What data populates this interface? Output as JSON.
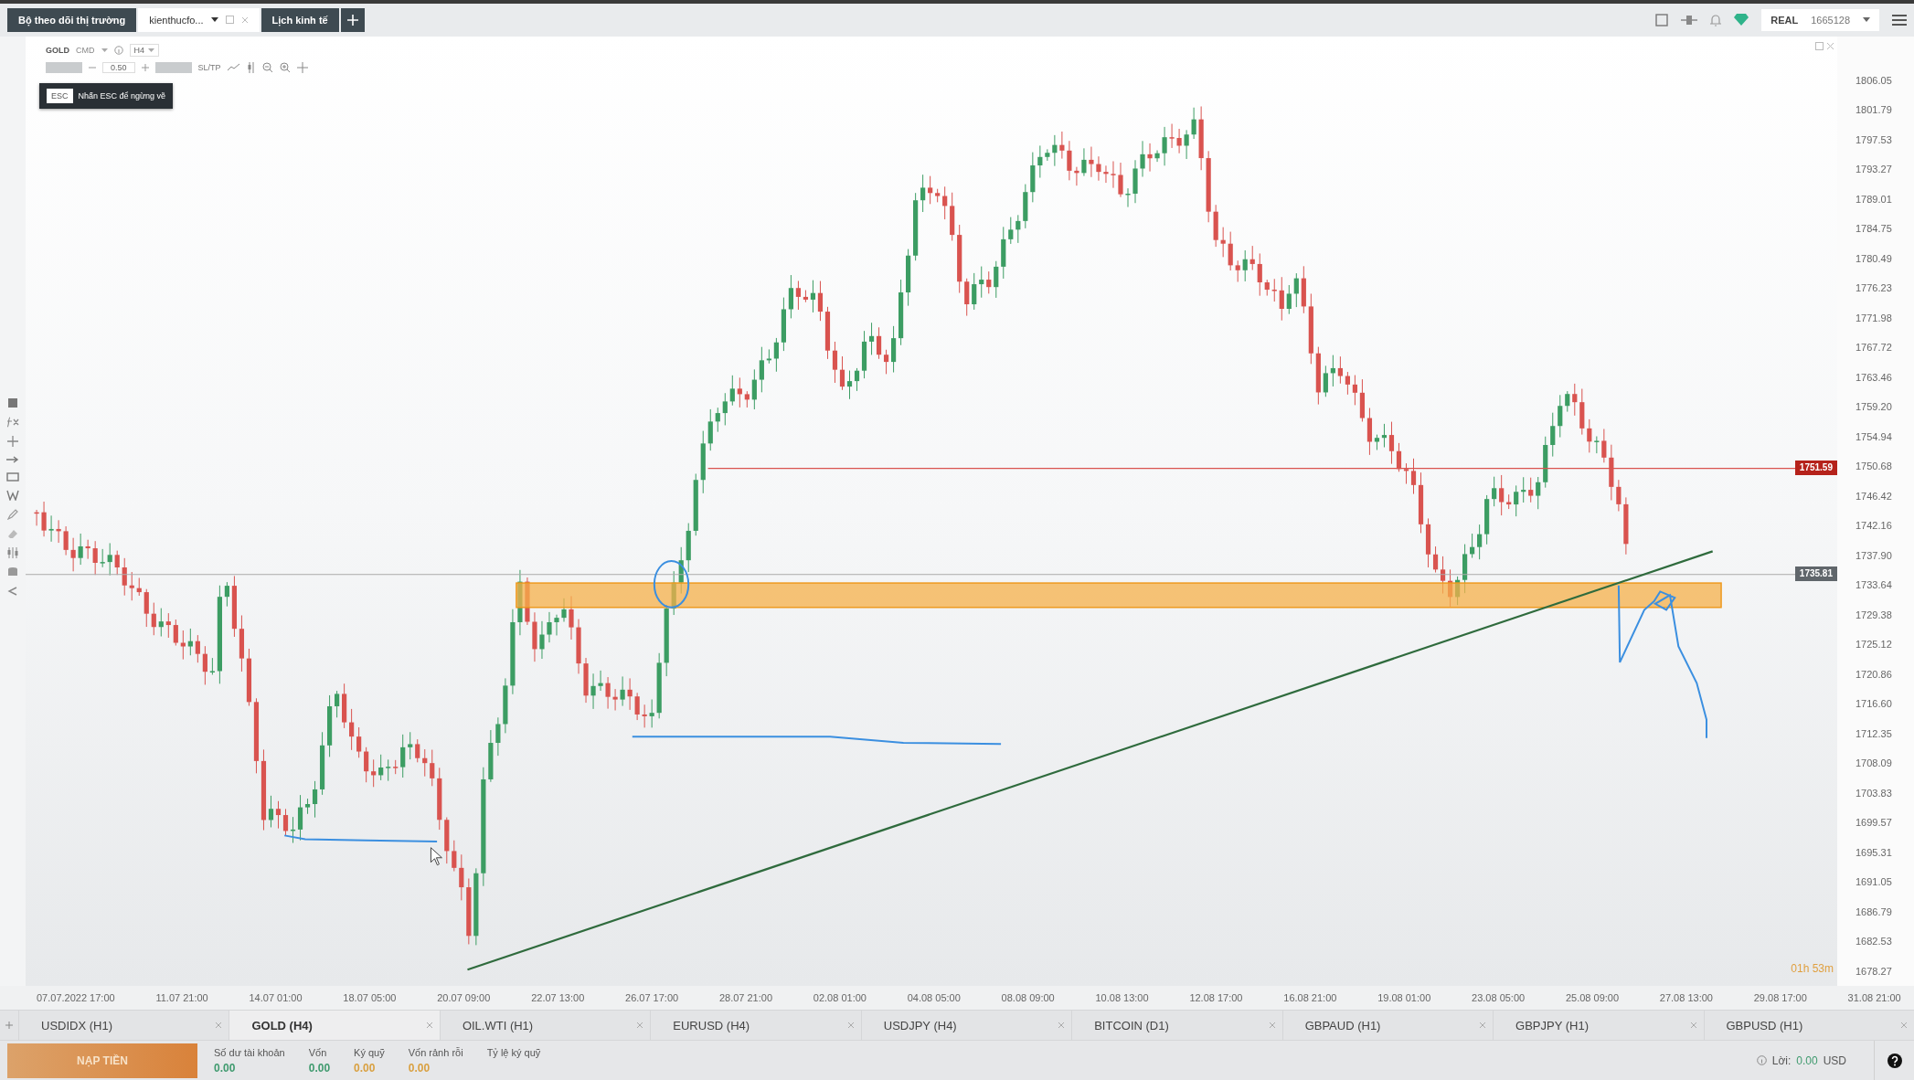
{
  "top_tabs": [
    {
      "label": "Bộ theo dõi thị trường",
      "selected": false,
      "kind": "plain"
    },
    {
      "label": "kienthucfo...",
      "selected": true,
      "kind": "dropdown"
    },
    {
      "label": "Lịch kinh tế",
      "selected": false,
      "kind": "plain"
    }
  ],
  "account": {
    "mode": "REAL",
    "number": "1665128"
  },
  "chart_toolbar": {
    "symbol": "GOLD",
    "market": "CMD",
    "timeframe": "H4",
    "volume": "0.50",
    "sltp": "SL/TP"
  },
  "tooltip": {
    "key": "ESC",
    "text": "Nhấn ESC để ngừng vẽ"
  },
  "y_axis": [
    "1806.05",
    "1801.79",
    "1797.53",
    "1793.27",
    "1789.01",
    "1784.75",
    "1780.49",
    "1776.23",
    "1771.98",
    "1767.72",
    "1763.46",
    "1759.20",
    "1754.94",
    "1750.68",
    "1746.42",
    "1742.16",
    "1737.90",
    "1733.64",
    "1729.38",
    "1725.12",
    "1720.86",
    "1716.60",
    "1712.35",
    "1708.09",
    "1703.83",
    "1699.57",
    "1695.31",
    "1691.05",
    "1686.79",
    "1682.53",
    "1678.27"
  ],
  "x_axis": [
    "07.07.2022 17:00",
    "11.07 21:00",
    "14.07 01:00",
    "18.07 05:00",
    "20.07 09:00",
    "22.07 13:00",
    "26.07 17:00",
    "28.07 21:00",
    "02.08 01:00",
    "04.08 05:00",
    "08.08 09:00",
    "10.08 13:00",
    "12.08 17:00",
    "16.08 21:00",
    "19.08 01:00",
    "23.08 05:00",
    "25.08 09:00",
    "27.08 13:00",
    "29.08 17:00",
    "31.08 21:00"
  ],
  "price_tags": [
    {
      "kind": "alert",
      "label": "1751.59"
    },
    {
      "kind": "current",
      "label": "1735.81"
    }
  ],
  "countdown": "01h 53m",
  "symbol_tabs": [
    {
      "label": "USDIDX (H1)",
      "selected": false
    },
    {
      "label": "GOLD (H4)",
      "selected": true
    },
    {
      "label": "OIL.WTI (H1)",
      "selected": false
    },
    {
      "label": "EURUSD (H4)",
      "selected": false
    },
    {
      "label": "USDJPY (H4)",
      "selected": false
    },
    {
      "label": "BITCOIN (D1)",
      "selected": false
    },
    {
      "label": "GBPAUD (H1)",
      "selected": false
    },
    {
      "label": "GBPJPY (H1)",
      "selected": false
    },
    {
      "label": "GBPUSD (H1)",
      "selected": false
    }
  ],
  "account_bar": {
    "deposit": "NẠP TIỀN",
    "fields": [
      {
        "label": "Số dư tài khoản",
        "value": "0.00",
        "color": "#3f9a6e"
      },
      {
        "label": "Vốn",
        "value": "0.00",
        "color": "#3f9a6e"
      },
      {
        "label": "Ký quỹ",
        "value": "0.00",
        "color": "#d9a040"
      },
      {
        "label": "Vốn rảnh rỗi",
        "value": "0.00",
        "color": "#d9a040"
      },
      {
        "label": "Tỷ lệ ký quỹ"
      }
    ],
    "profit": {
      "label": "Lời:",
      "value": "0.00",
      "currency": "USD"
    }
  }
}
